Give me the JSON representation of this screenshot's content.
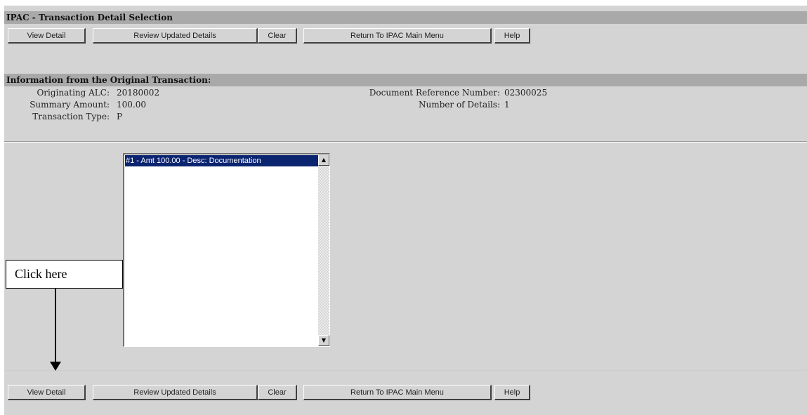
{
  "header": {
    "title": "IPAC - Transaction Detail Selection"
  },
  "toolbar": {
    "view_detail": "View Detail",
    "review_updated": "Review Updated Details",
    "clear": "Clear",
    "return_main": "Return To IPAC Main Menu",
    "help": "Help"
  },
  "info": {
    "title": "Information from the Original Transaction:",
    "originating_alc_label": "Originating ALC:",
    "originating_alc_value": "20180002",
    "summary_amount_label": "Summary Amount:",
    "summary_amount_value": "100.00",
    "transaction_type_label": "Transaction Type:",
    "transaction_type_value": "P",
    "doc_ref_label": "Document Reference Number:",
    "doc_ref_value": "02300025",
    "num_details_label": "Number of Details:",
    "num_details_value": "1"
  },
  "details_list": {
    "items": [
      "#1 - Amt 100.00 - Desc: Documentation"
    ],
    "selected_index": 0
  },
  "annotation": {
    "callout_text": "Click here"
  },
  "colors": {
    "page_bg": "#d4d4d4",
    "section_bar": "#a9a9a9",
    "selection": "#0a2470"
  },
  "icons": {
    "scroll_up": "scroll-up-icon",
    "scroll_down": "scroll-down-icon"
  }
}
